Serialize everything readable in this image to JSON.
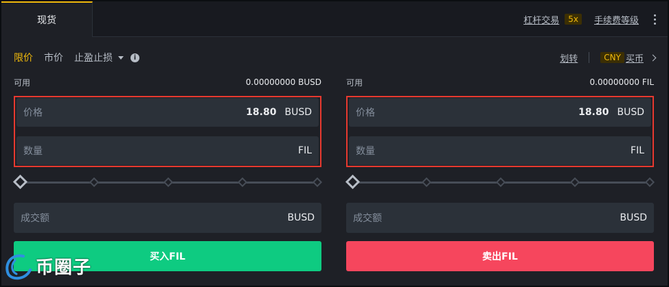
{
  "header": {
    "tab_spot": "现货",
    "margin_link": "杠杆交易",
    "leverage_badge": "5x",
    "fee_link": "手续费等级"
  },
  "order_types": {
    "limit": "限价",
    "market": "市价",
    "stop_limit": "止盈止损"
  },
  "top_right": {
    "transfer": "划转",
    "currency_badge": "CNY",
    "buy_crypto": "买币"
  },
  "buy": {
    "available_label": "可用",
    "available_amount": "0.00000000 BUSD",
    "price_label": "价格",
    "price_value": "18.80",
    "price_unit": "BUSD",
    "amount_label": "数量",
    "amount_value": "",
    "amount_unit": "FIL",
    "total_label": "成交额",
    "total_unit": "BUSD",
    "button": "买入FIL"
  },
  "sell": {
    "available_label": "可用",
    "available_amount": "0.00000000 FIL",
    "price_label": "价格",
    "price_value": "18.80",
    "price_unit": "BUSD",
    "amount_label": "数量",
    "amount_value": "",
    "amount_unit": "FIL",
    "total_label": "成交额",
    "total_unit": "BUSD",
    "button": "卖出FIL"
  },
  "watermark": {
    "text": "币圈子"
  },
  "colors": {
    "accent": "#f0b90b",
    "buy": "#0ecb81",
    "sell": "#f6465d",
    "highlight_box": "#e8392f"
  }
}
